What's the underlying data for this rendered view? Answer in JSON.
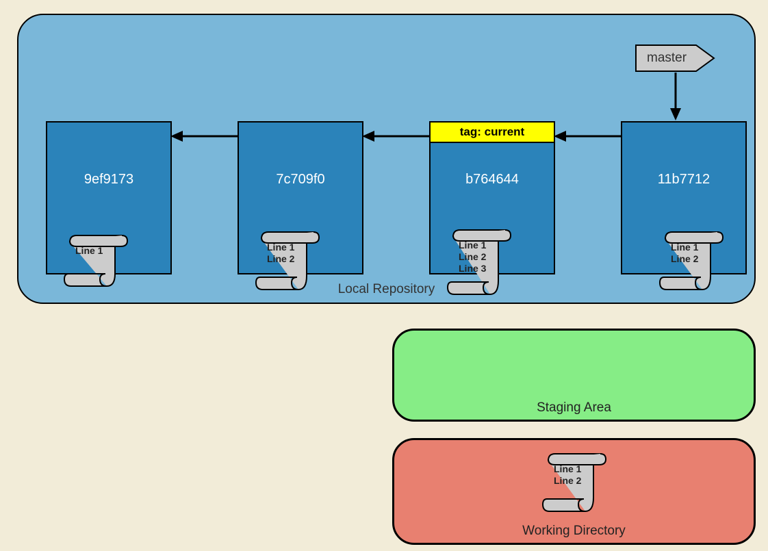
{
  "repo": {
    "label": "Local Repository",
    "master_label": "master",
    "tag_label": "tag: current",
    "commits": [
      {
        "hash": "9ef9173",
        "file": "Line 1"
      },
      {
        "hash": "7c709f0",
        "file": "Line 1\nLine 2"
      },
      {
        "hash": "b764644",
        "file": "Line 1\nLine 2\nLine 3"
      },
      {
        "hash": "11b7712",
        "file": "Line 1\nLine 2"
      }
    ]
  },
  "staging": {
    "label": "Staging Area"
  },
  "workdir": {
    "label": "Working Directory",
    "file": "Line 1\nLine 2"
  }
}
